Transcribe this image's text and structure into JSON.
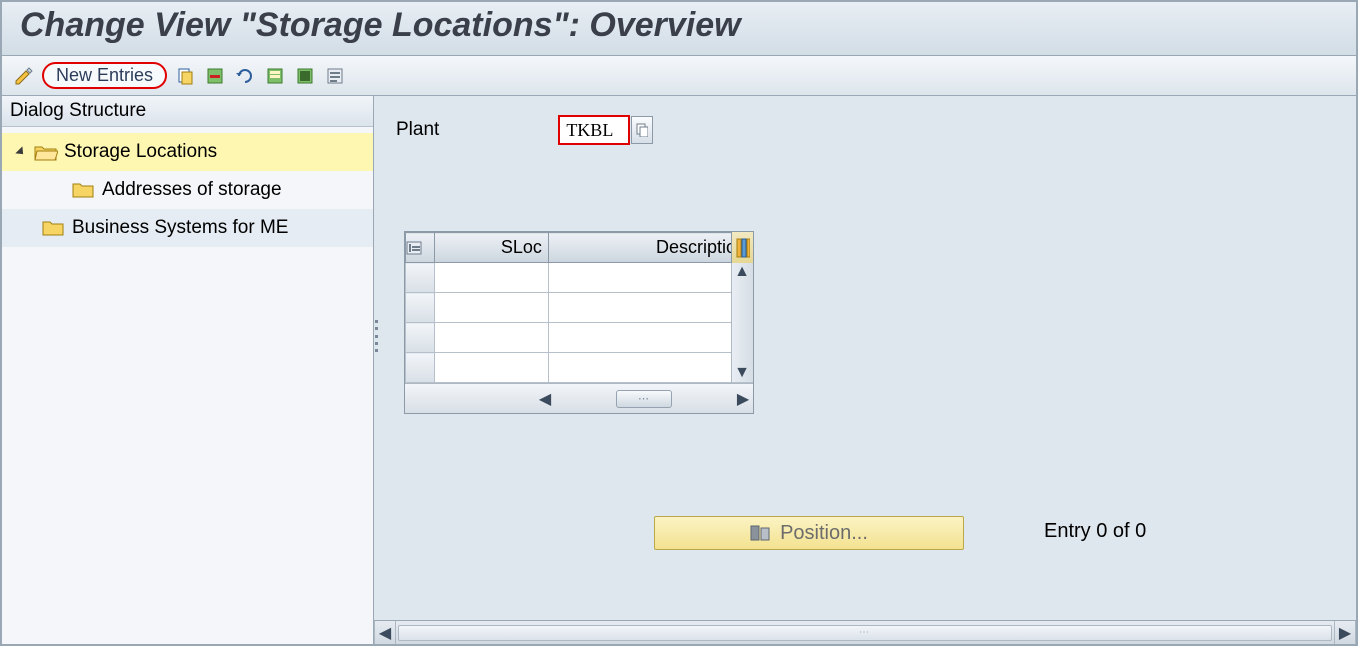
{
  "title": "Change View \"Storage Locations\": Overview",
  "toolbar": {
    "new_entries": "New Entries"
  },
  "sidebar": {
    "header": "Dialog Structure",
    "items": [
      {
        "label": "Storage Locations",
        "open": true,
        "selected": true
      },
      {
        "label": "Addresses of storage",
        "indent": 1
      },
      {
        "label": "Business Systems for ME",
        "indent": 0
      }
    ]
  },
  "plant": {
    "label": "Plant",
    "value": "TKBL"
  },
  "grid": {
    "columns": {
      "sloc": "SLoc",
      "description": "Description"
    },
    "rows": [
      {},
      {},
      {},
      {}
    ]
  },
  "position_label": "Position...",
  "entry_text": "Entry 0 of 0"
}
